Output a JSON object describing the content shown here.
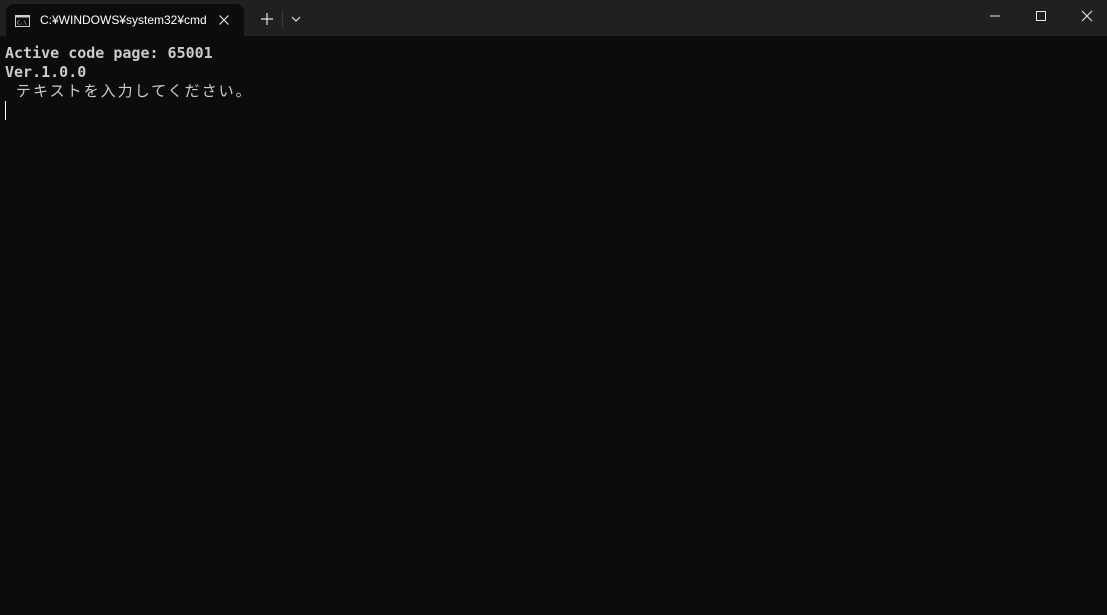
{
  "titlebar": {
    "tab_title": "C:¥WINDOWS¥system32¥cmd",
    "tab_icon": "cmd-icon",
    "close_tab_icon": "close-icon",
    "new_tab_icon": "plus-icon",
    "dropdown_icon": "chevron-down-icon",
    "window_controls": [
      "minimize-icon",
      "maximize-icon",
      "close-icon"
    ]
  },
  "terminal": {
    "lines": [
      "Active code page: 65001",
      "Ver.1.0.0",
      " テキストを入力してください。"
    ]
  },
  "colors": {
    "titlebar_bg": "#202020",
    "terminal_bg": "#0c0c0c",
    "text": "#cccccc",
    "tab_text": "#ffffff"
  }
}
